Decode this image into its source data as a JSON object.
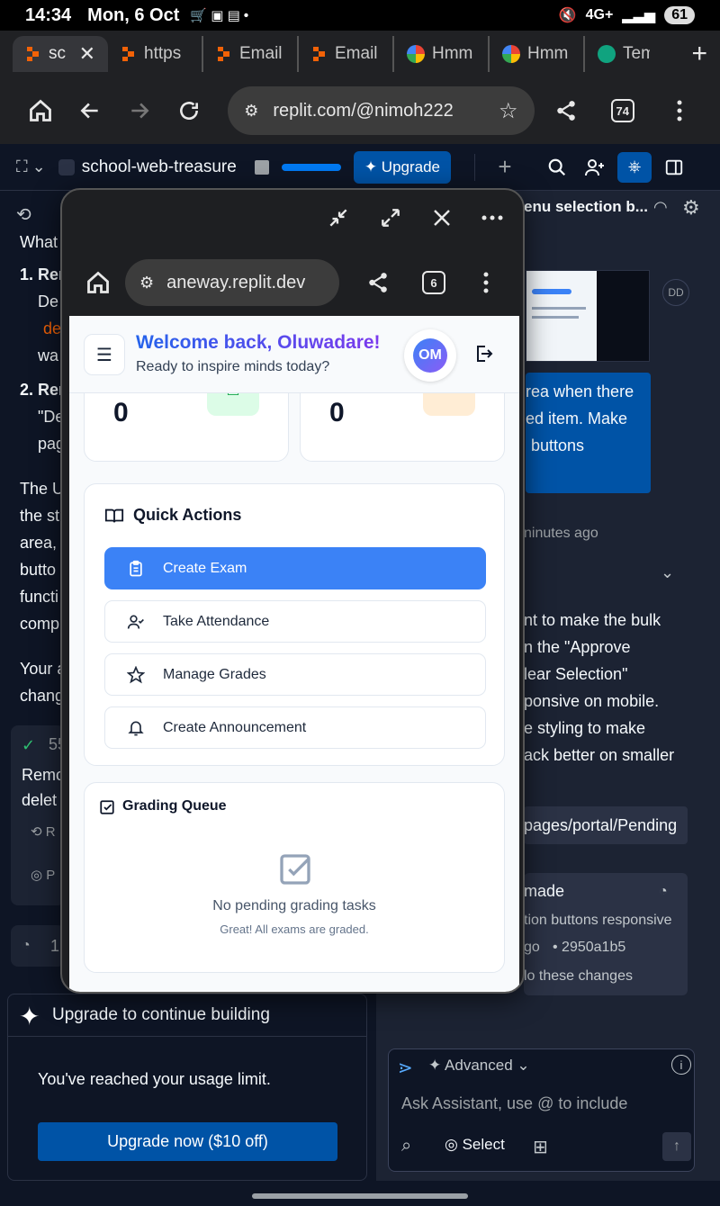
{
  "status": {
    "time": "14:34",
    "date": "Mon, 6 Oct",
    "network": "4G+",
    "battery": "61"
  },
  "tabs": [
    {
      "label": "sch",
      "icon": "replit-icon",
      "active": true
    },
    {
      "label": "https",
      "icon": "replit-icon"
    },
    {
      "label": "Email",
      "icon": "replit-icon"
    },
    {
      "label": "Email",
      "icon": "replit-icon"
    },
    {
      "label": "Hmm",
      "icon": "google-icon"
    },
    {
      "label": "Hmm",
      "icon": "google-icon"
    },
    {
      "label": "Tem",
      "icon": "chatgpt-icon"
    }
  ],
  "browser": {
    "url": "replit.com/@nimoh222",
    "tab_count": "74"
  },
  "replit": {
    "project": "school-web-treasure",
    "upgrade": "Upgrade",
    "right_title": "enu selection b..."
  },
  "left": {
    "lines": [
      "What",
      "1. Rem",
      "De",
      "de",
      "wa",
      "2. Rem",
      "\"De",
      "pag",
      "The U",
      "the st",
      "area,",
      "butto",
      "functi",
      "comp",
      "Your a",
      "chang"
    ],
    "checkpoint": "55",
    "remove_1": "Remo",
    "remove_2": "delet",
    "r": "R",
    "p": "P",
    "one": "1"
  },
  "upgrade_box": {
    "title": "Upgrade to continue building",
    "message": "You've reached your usage limit.",
    "button": "Upgrade now ($10 off)"
  },
  "right": {
    "avatar": "DD",
    "msg_lines": [
      "rea when there",
      "ed item. Make",
      "buttons"
    ],
    "time": "ninutes ago",
    "body": [
      "nt to make the bulk",
      "n the \"Approve",
      "lear Selection\"",
      "ponsive on mobile.",
      "e styling to make",
      "ack better on smaller"
    ],
    "file": "pages/portal/Pending",
    "change_title": "made",
    "change_desc": "tion buttons responsive",
    "change_time": "go",
    "commit": "• 2950a1b5",
    "undo": "lo these changes",
    "advanced": "Advanced",
    "placeholder": "Ask Assistant, use @ to include",
    "select": "Select"
  },
  "popup": {
    "url": "aneway.replit.dev",
    "tab_count": "6",
    "welcome": "Welcome back, Oluwadare!",
    "sub": "Ready to inspire minds today?",
    "avatar": "OM",
    "stat1": "0",
    "stat2": "0",
    "qa_title": "Quick Actions",
    "actions": [
      "Create Exam",
      "Take Attendance",
      "Manage Grades",
      "Create Announcement"
    ],
    "gq_title": "Grading Queue",
    "gq_empty": "No pending grading tasks",
    "gq_sub": "Great! All exams are graded."
  },
  "colors": {
    "primary": "#3b82f6",
    "welcome_from": "#2563eb",
    "welcome_to": "#7c3aed",
    "upgrade": "#0053a6"
  }
}
